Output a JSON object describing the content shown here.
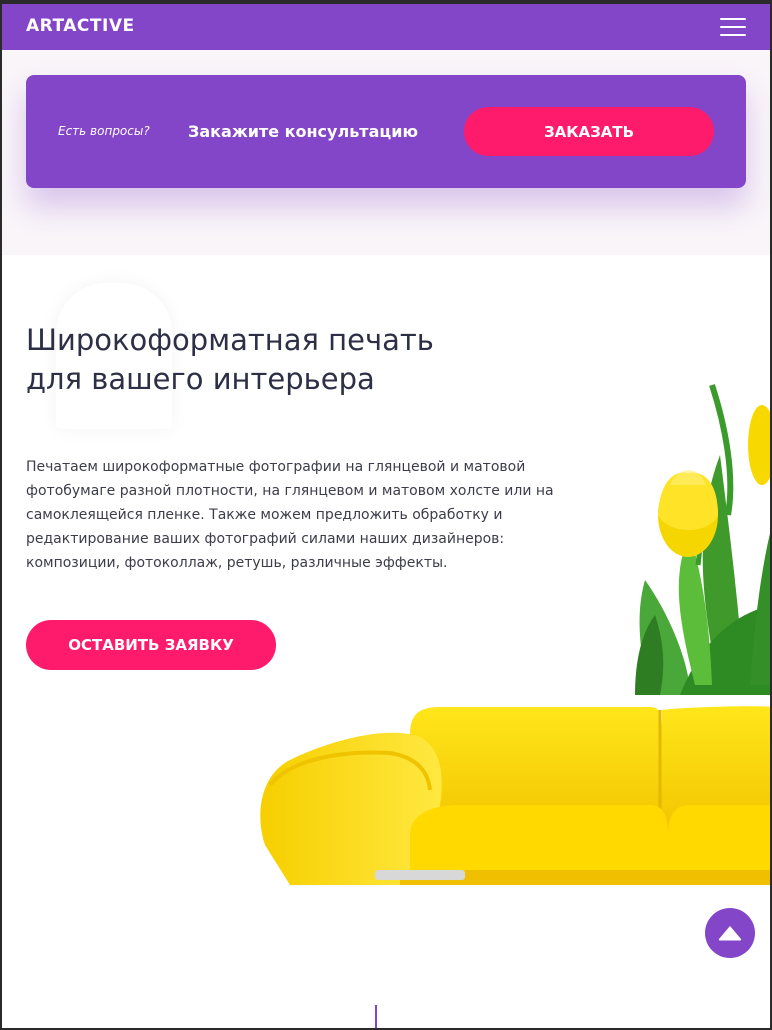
{
  "header": {
    "logo": "ARTACTIVE",
    "menu_icon": "hamburger-icon"
  },
  "cta": {
    "question": "Есть вопросы?",
    "text": "Закажите консультацию",
    "button": "ЗАКАЗАТЬ"
  },
  "hero": {
    "title_line1": "Широкоформатная печать",
    "title_line2": "для вашего интерьера",
    "description": "Печатаем широкоформатные фотографии на глянцевой и матовой фотобумаге разной плотности, на глянцевом и матовом холсте или на самоклеящейся пленке. Также можем предложить обработку и редактирование ваших фотографий силами наших дизайнеров: композиции, фотоколлаж, ретушь, различные эффекты.",
    "button": "ОСТАВИТЬ ЗАЯВКУ"
  },
  "scroll_top_icon": "arrow-up-icon",
  "colors": {
    "brand_purple": "#8446c8",
    "accent_pink": "#ff1b6b",
    "text_dark": "#2c2f45"
  }
}
